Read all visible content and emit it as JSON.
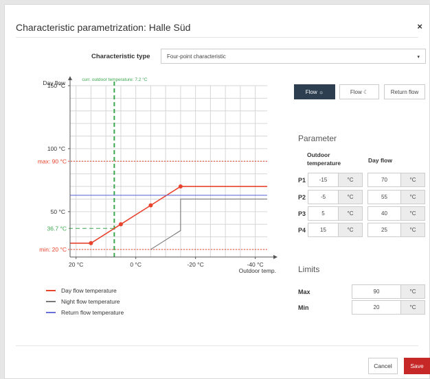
{
  "dialog": {
    "title": "Characteristic parametrization: Halle Süd",
    "close_glyph": "×"
  },
  "characteristic_type": {
    "label": "Characteristic type",
    "value": "Four-point characteristic",
    "caret_glyph": "▾"
  },
  "mode_buttons": {
    "flow_sun": "Flow ☼",
    "flow_moon": "Flow ☾",
    "return_flow": "Return flow",
    "active": "flow_sun"
  },
  "chart_data": {
    "type": "line",
    "ylabel": "Day flow",
    "xlabel": "Outdoor temp.",
    "xlim": [
      22,
      -44
    ],
    "ylim": [
      14,
      150
    ],
    "x_ticks": [
      {
        "value": 20,
        "label": "20 °C"
      },
      {
        "value": 0,
        "label": "0 °C"
      },
      {
        "value": -20,
        "label": "-20 °C"
      },
      {
        "value": -40,
        "label": "-40 °C"
      }
    ],
    "y_ticks": [
      {
        "value": 150,
        "label": "150 °C"
      },
      {
        "value": 100,
        "label": "100 °C"
      },
      {
        "value": 50,
        "label": "50 °C"
      }
    ],
    "max_line": {
      "value": 90,
      "label": "max: 90 °C"
    },
    "min_line": {
      "value": 20,
      "label": "min: 20 °C"
    },
    "current_outdoor": {
      "x": 7.2,
      "label": "curr. outdoor temperature: 7.2 °C"
    },
    "current_flow": {
      "value": 36.7,
      "label": "36.7 °C"
    },
    "series": [
      {
        "name": "Day flow temperature",
        "color": "#e8412c",
        "points": [
          [
            22,
            25
          ],
          [
            15,
            25
          ],
          [
            5,
            40
          ],
          [
            -5,
            55
          ],
          [
            -15,
            70
          ],
          [
            -44,
            70
          ]
        ],
        "markers": [
          [
            15,
            25
          ],
          [
            5,
            40
          ],
          [
            -5,
            55
          ],
          [
            -15,
            70
          ]
        ]
      },
      {
        "name": "Night flow temperature",
        "color": "#777777",
        "points": [
          [
            -5,
            20
          ],
          [
            -15,
            35
          ],
          [
            -15,
            60
          ],
          [
            -44,
            60
          ]
        ],
        "markers": []
      },
      {
        "name": "Return flow temperature",
        "color": "#6670d9",
        "points": [
          [
            22,
            63
          ],
          [
            -44,
            63
          ]
        ],
        "markers": []
      }
    ],
    "colors": {
      "grid": "#d6d6d6",
      "limit": "#e8412c",
      "current": "#3aa64c",
      "axis": "#555555"
    }
  },
  "parameter": {
    "heading": "Parameter",
    "col_outdoor": "Outdoor temperature",
    "col_flow": "Day flow",
    "unit": "°C",
    "rows": [
      {
        "label": "P1",
        "outdoor": "-15",
        "flow": "70"
      },
      {
        "label": "P2",
        "outdoor": "-5",
        "flow": "55"
      },
      {
        "label": "P3",
        "outdoor": "5",
        "flow": "40"
      },
      {
        "label": "P4",
        "outdoor": "15",
        "flow": "25"
      }
    ]
  },
  "limits": {
    "heading": "Limits",
    "max_label": "Max",
    "max_value": "90",
    "min_label": "Min",
    "min_value": "20",
    "unit": "°C"
  },
  "footer": {
    "cancel": "Cancel",
    "save": "Save",
    "save_color": "#c62828"
  }
}
